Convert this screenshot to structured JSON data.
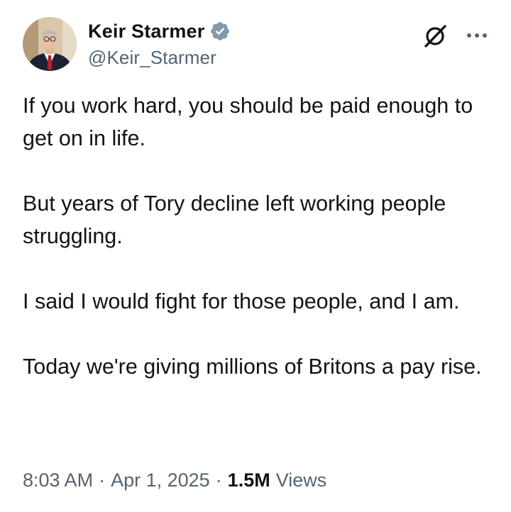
{
  "author": {
    "display_name": "Keir Starmer",
    "handle": "@Keir_Starmer",
    "verified": true,
    "verified_color": "#829aab"
  },
  "icons": {
    "avatar": "profile-photo",
    "verified": "verified-badge-icon",
    "grok": "grok-icon",
    "more": "more-options-icon"
  },
  "tweet": {
    "paragraphs": [
      "If you work hard, you should be paid enough to get on in life.",
      "But years of Tory decline left working people struggling.",
      "I said I would fight for those people, and I am.",
      "Today we're giving millions of Britons a pay rise."
    ]
  },
  "meta": {
    "time": "8:03 AM",
    "separator": "·",
    "date": "Apr 1, 2025",
    "views_count": "1.5M",
    "views_label": "Views"
  },
  "colors": {
    "text_primary": "#0f1419",
    "text_secondary": "#536471"
  }
}
